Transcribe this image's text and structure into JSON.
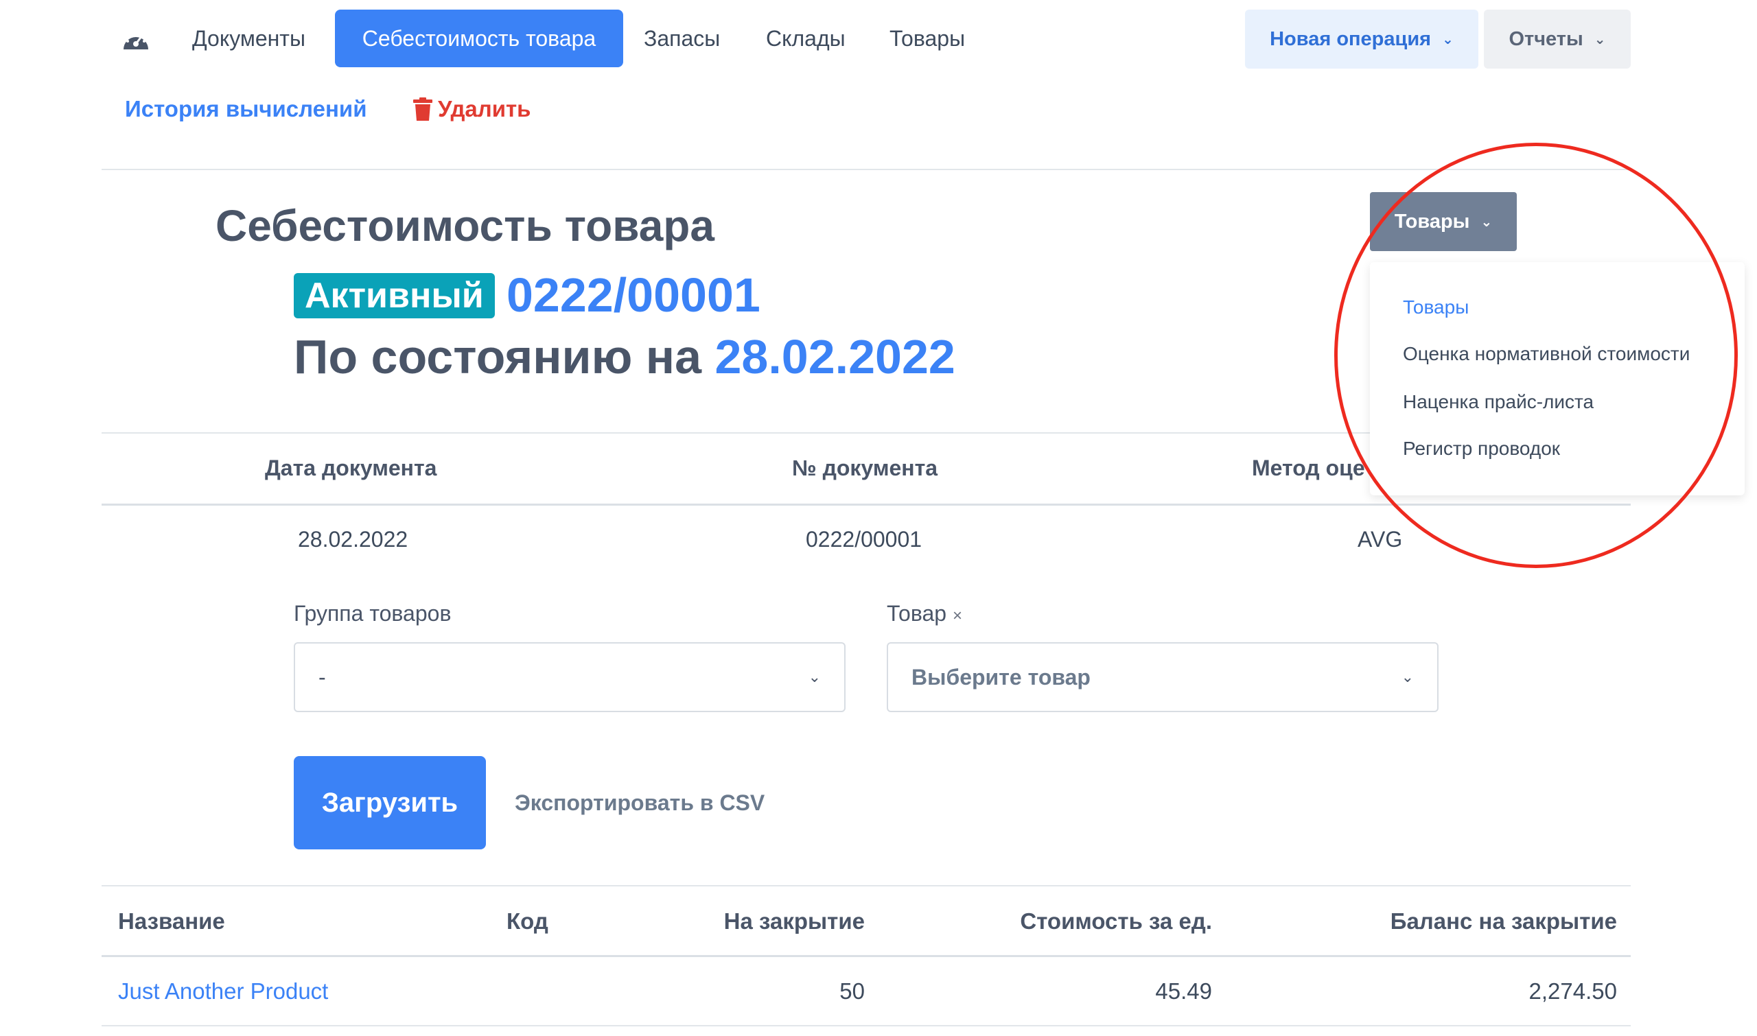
{
  "nav": {
    "items": [
      {
        "label": "Документы"
      },
      {
        "label": "Себестоимость товара",
        "active": true
      },
      {
        "label": "Запасы"
      },
      {
        "label": "Склады"
      },
      {
        "label": "Товары"
      }
    ],
    "new_operation_label": "Новая операция",
    "reports_label": "Отчеты"
  },
  "sub_actions": {
    "history_label": "История вычислений",
    "delete_label": "Удалить"
  },
  "header": {
    "title": "Себестоимость товара",
    "status_badge": "Активный",
    "doc_number": "0222/00001",
    "as_of_prefix": "По состоянию на",
    "as_of_date": "28.02.2022"
  },
  "products_dropdown": {
    "button_label": "Товары",
    "items": [
      {
        "label": "Товары"
      },
      {
        "label": "Оценка нормативной стоимости"
      },
      {
        "label": "Наценка прайс-листа"
      },
      {
        "label": "Регистр проводок"
      }
    ]
  },
  "info_table": {
    "headers": [
      "Дата документа",
      "№ документа",
      "Метод оце"
    ],
    "values": [
      "28.02.2022",
      "0222/00001",
      "AVG"
    ]
  },
  "filters": {
    "group_label": "Группа товаров",
    "group_value": "-",
    "product_label": "Товар",
    "product_clear": "×",
    "product_placeholder": "Выберите товар"
  },
  "actions": {
    "load_label": "Загрузить",
    "export_label": "Экспортировать в CSV"
  },
  "results": {
    "columns": [
      "Название",
      "Код",
      "На закрытие",
      "Стоимость за ед.",
      "Баланс на закрытие"
    ],
    "rows": [
      {
        "name": "Just Another Product",
        "code": "",
        "closing_qty": "50",
        "unit_cost": "45.49",
        "closing_balance": "2,274.50"
      }
    ]
  },
  "colors": {
    "primary": "#3b82f6",
    "badge": "#0aa2b8",
    "danger": "#e03b31",
    "highlight_circle": "#ee2a1f"
  },
  "icons": {
    "dashboard": "gauge-icon",
    "delete": "trash-icon",
    "dropdown": "chevron-down-icon"
  }
}
